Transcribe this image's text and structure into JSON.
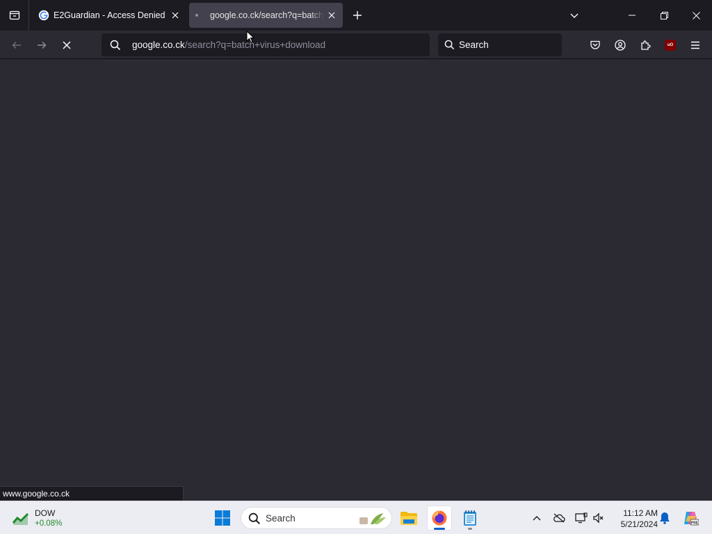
{
  "tabs": [
    {
      "title": "E2Guardian - Access Denied",
      "active": false
    },
    {
      "title": "google.co.ck/search?q=batch+virus+download",
      "active": true
    }
  ],
  "urlbar": {
    "host": "google.co.ck",
    "path": "/search?q=batch+virus+download"
  },
  "searchbar": {
    "placeholder": "Search"
  },
  "statusbar": {
    "text": "www.google.co.ck"
  },
  "taskbar": {
    "widget": {
      "name": "DOW",
      "change": "+0.08%"
    },
    "search_placeholder": "Search",
    "clock": {
      "time": "11:12 AM",
      "date": "5/21/2024"
    }
  },
  "icons": {
    "tab_list": "tab-list-icon",
    "new_tab": "plus-icon",
    "reload_stop": "stop-icon",
    "pocket": "pocket-icon",
    "account": "account-icon",
    "extensions": "extensions-icon",
    "ublock": "ublock-origin-icon",
    "menu": "hamburger-menu-icon"
  },
  "colors": {
    "tabbar_bg": "#1c1b22",
    "toolbar_bg": "#2b2a33",
    "active_tab_bg": "#42414d",
    "taskbar_bg": "#ecedf2",
    "dow_green": "#1e8a2e"
  }
}
